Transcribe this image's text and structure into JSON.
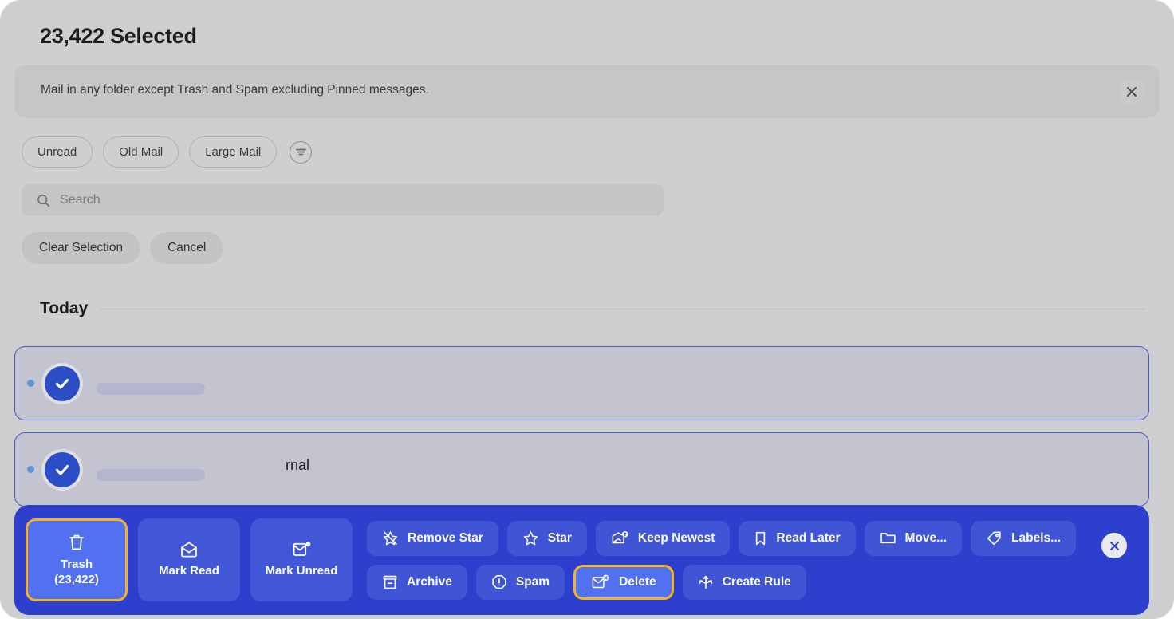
{
  "header": {
    "title": "23,422 Selected"
  },
  "banner": {
    "text": "Mail in any folder except Trash and Spam excluding Pinned messages.",
    "close_icon": "close-icon"
  },
  "filters": {
    "chips": [
      {
        "label": "Unread"
      },
      {
        "label": "Old Mail"
      },
      {
        "label": "Large Mail"
      }
    ],
    "filter_icon": "filter-list-icon"
  },
  "search": {
    "placeholder": "Search",
    "value": "",
    "icon": "search-icon"
  },
  "actions": {
    "clear_selection_label": "Clear Selection",
    "cancel_label": "Cancel"
  },
  "list": {
    "day_label": "Today",
    "rows": [
      {
        "partial_subject": ""
      },
      {
        "partial_subject": "rnal"
      }
    ]
  },
  "toolbar": {
    "primary": [
      {
        "name": "trash",
        "label_line1": "Trash",
        "label_line2": "(23,422)",
        "icon": "trash-icon",
        "highlighted": true
      },
      {
        "name": "mark-read",
        "label_line1": "Mark Read",
        "label_line2": "",
        "icon": "envelope-open-icon",
        "highlighted": false
      },
      {
        "name": "mark-unread",
        "label_line1": "Mark Unread",
        "label_line2": "",
        "icon": "envelope-unread-icon",
        "highlighted": false
      }
    ],
    "row1": [
      {
        "name": "remove-star",
        "label": "Remove Star",
        "icon": "star-slash-icon",
        "highlighted": false
      },
      {
        "name": "star",
        "label": "Star",
        "icon": "star-icon",
        "highlighted": false
      },
      {
        "name": "keep-newest",
        "label": "Keep Newest",
        "icon": "envelope-arrow-up-icon",
        "highlighted": false
      },
      {
        "name": "read-later",
        "label": "Read Later",
        "icon": "bookmark-icon",
        "highlighted": false
      },
      {
        "name": "move",
        "label": "Move...",
        "icon": "folder-icon",
        "highlighted": false
      },
      {
        "name": "labels",
        "label": "Labels...",
        "icon": "tag-icon",
        "highlighted": false
      }
    ],
    "row2": [
      {
        "name": "archive",
        "label": "Archive",
        "icon": "archive-box-icon",
        "highlighted": false
      },
      {
        "name": "spam",
        "label": "Spam",
        "icon": "octagon-exclamation-icon",
        "highlighted": false
      },
      {
        "name": "delete",
        "label": "Delete",
        "icon": "envelope-x-icon",
        "highlighted": true
      },
      {
        "name": "create-rule",
        "label": "Create Rule",
        "icon": "arrows-branch-icon",
        "highlighted": false
      }
    ],
    "close_icon": "close-icon",
    "accent_highlight_color": "#f5b324",
    "toolbar_background_color": "#2c40cd",
    "button_background_color": "#4055d5"
  }
}
